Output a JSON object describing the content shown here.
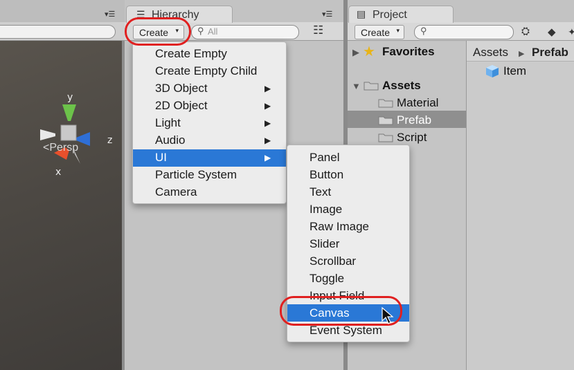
{
  "scene": {
    "menu_icon": "▾☰",
    "axis_y": "y",
    "axis_z": "z",
    "axis_x": "x",
    "persp_icon": "<",
    "persp_label": "Persp"
  },
  "hierarchy": {
    "tab_icon": "list-icon",
    "tab_label": "Hierarchy",
    "menu_icon": "▾☰",
    "create_label": "Create",
    "search_placeholder": "All",
    "filter_icon": "filter-icon"
  },
  "create_menu": {
    "items": [
      {
        "label": "Create Empty",
        "submenu": false
      },
      {
        "label": "Create Empty Child",
        "submenu": false
      },
      {
        "label": "3D Object",
        "submenu": true
      },
      {
        "label": "2D Object",
        "submenu": true
      },
      {
        "label": "Light",
        "submenu": true
      },
      {
        "label": "Audio",
        "submenu": true
      },
      {
        "label": "UI",
        "submenu": true,
        "highlighted": true
      },
      {
        "label": "Particle System",
        "submenu": false
      },
      {
        "label": "Camera",
        "submenu": false
      }
    ]
  },
  "ui_submenu": {
    "items": [
      {
        "label": "Panel"
      },
      {
        "label": "Button"
      },
      {
        "label": "Text"
      },
      {
        "label": "Image"
      },
      {
        "label": "Raw Image"
      },
      {
        "label": "Slider"
      },
      {
        "label": "Scrollbar"
      },
      {
        "label": "Toggle"
      },
      {
        "label": "Input Field"
      },
      {
        "label": "Canvas",
        "highlighted": true
      },
      {
        "label": "Event System"
      }
    ]
  },
  "project": {
    "tab_icon": "folder-icon",
    "tab_label": "Project",
    "create_label": "Create",
    "tree": {
      "favorites": "Favorites",
      "assets": "Assets",
      "children": [
        "Material",
        "Prefab",
        "Script"
      ],
      "selected": "Prefab"
    },
    "breadcrumb": [
      "Assets",
      "Prefab"
    ],
    "items": [
      {
        "label": "Item",
        "icon": "prefab-cube-icon"
      }
    ]
  },
  "colors": {
    "highlight": "#2a78d6",
    "annotation": "#e02020"
  }
}
